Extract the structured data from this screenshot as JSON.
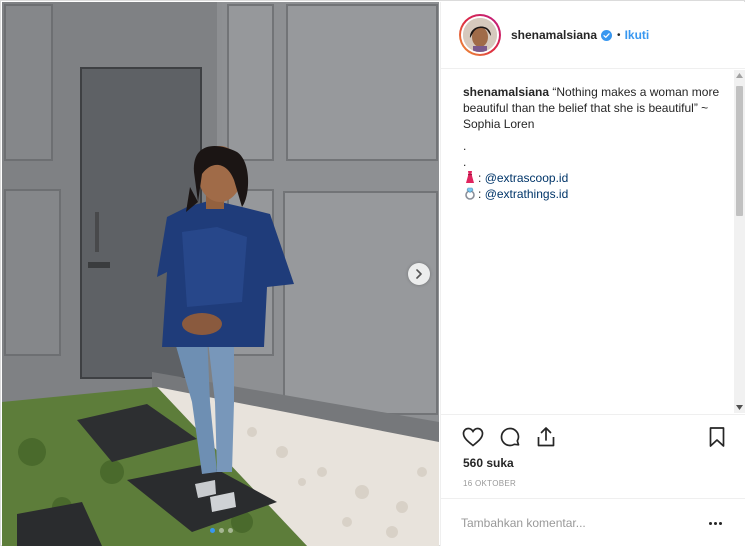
{
  "post": {
    "username": "shenamalsiana",
    "follow_label": "Ikuti",
    "bullet": "•",
    "verified_icon": "verified-badge-icon",
    "caption": {
      "username": "shenamalsiana",
      "text": "“Nothing makes a woman more beautiful than the belief that she is beautiful” ~ Sophia Loren",
      "dot1": ".",
      "dot2": ".",
      "mention1": "@extrascoop.id",
      "mention2": "@extrathings.id",
      "mention_separator": ":"
    },
    "likes": "560 suka",
    "date": "16 OKTOBER",
    "comment_placeholder": "Tambahkan komentar...",
    "carousel": {
      "total": 3,
      "active": 1
    }
  },
  "colors": {
    "accent": "#3897f0",
    "text": "#262626",
    "muted": "#999999",
    "border": "#efefef"
  }
}
